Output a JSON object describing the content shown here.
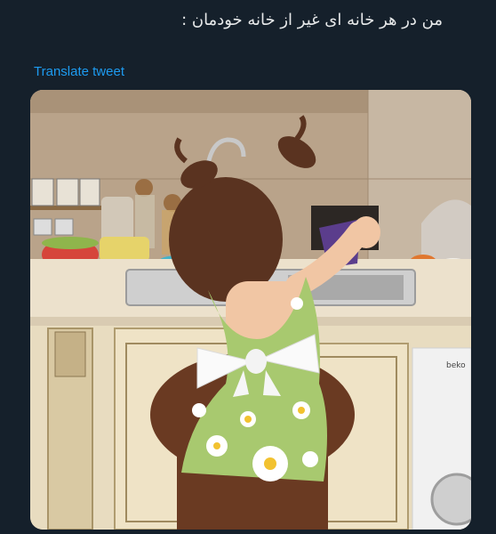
{
  "tweet": {
    "text": "من در هر خانه ای غیر از خانه خودمان :",
    "translate_label": "Translate tweet"
  },
  "media": {
    "type": "photo",
    "washing_machine_brand": "beko"
  },
  "colors": {
    "background": "#15202b",
    "text": "#e7e9ea",
    "link": "#1d9bf0"
  }
}
